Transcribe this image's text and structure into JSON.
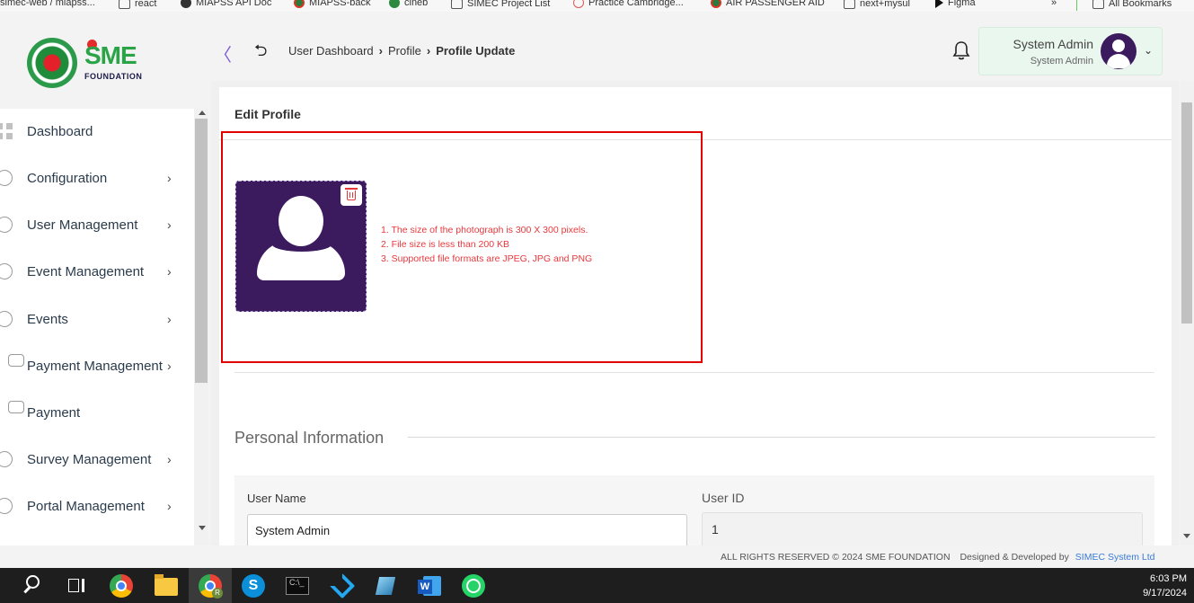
{
  "bookmarks": [
    {
      "label": "simec-web / miapss...",
      "icon": "text"
    },
    {
      "label": "react",
      "icon": "folder-icon"
    },
    {
      "label": "MIAPSS API Doc",
      "icon": "globe-icon"
    },
    {
      "label": "MIAPSS-back",
      "icon": "seal-icon"
    },
    {
      "label": "cineb",
      "icon": "play-icon"
    },
    {
      "label": "SIMEC Project List",
      "icon": "folder-icon"
    },
    {
      "label": "Practice Cambridge...",
      "icon": "circle-icon"
    },
    {
      "label": "AIR PASSENGER AID",
      "icon": "seal-icon"
    },
    {
      "label": "next+mysul",
      "icon": "folder-icon"
    },
    {
      "label": "Figma",
      "icon": "figma-icon"
    },
    {
      "label": "»",
      "icon": "text"
    },
    {
      "label": "All Bookmarks",
      "icon": "folder-icon"
    }
  ],
  "logo": {
    "brand": "SME",
    "tagline": "FOUNDATION"
  },
  "sidebar": {
    "items": [
      {
        "label": "Dashboard",
        "chevron": ""
      },
      {
        "label": "Configuration",
        "chevron": "›"
      },
      {
        "label": "User Management",
        "chevron": "›"
      },
      {
        "label": "Event Management",
        "chevron": "›"
      },
      {
        "label": "Events",
        "chevron": "›"
      },
      {
        "label": "Payment Management",
        "chevron": "›"
      },
      {
        "label": "Payment",
        "chevron": ""
      },
      {
        "label": "Survey Management",
        "chevron": "›"
      },
      {
        "label": "Portal Management",
        "chevron": "›"
      }
    ]
  },
  "header": {
    "collapse_icon": "〈",
    "back_icon": "⮌",
    "breadcrumb": [
      "User Dashboard",
      "Profile",
      "Profile Update"
    ],
    "breadcrumb_sep": "›",
    "user_name": "System Admin",
    "user_role": "System Admin",
    "caret": "⌄"
  },
  "card": {
    "title": "Edit Profile",
    "photo_rules": [
      "1. The size of the photograph is 300 X 300 pixels.",
      "2. File size is less than 200 KB",
      "3. Supported file formats are JPEG, JPG and PNG"
    ],
    "section_title": "Personal Information",
    "fields": {
      "username_label": "User Name",
      "username_value": "System Admin",
      "userid_label": "User ID",
      "userid_value": "1"
    }
  },
  "footer": {
    "rights": "ALL RIGHTS RESERVED © 2024 SME FOUNDATION",
    "designed": "Designed & Developed by",
    "company": "SIMEC System Ltd"
  },
  "taskbar": {
    "time": "6:03 PM",
    "date": "9/17/2024",
    "chrome_badge": "R",
    "skype_letter": "S",
    "word_letter": "W",
    "terminal_text": "C:\\_"
  },
  "colors": {
    "accent_purple": "#3b1a5e",
    "highlight_red": "#e00000",
    "rule_red": "#e8393d",
    "brand_green": "#2aa447",
    "footer_link": "#3a7bd5"
  }
}
